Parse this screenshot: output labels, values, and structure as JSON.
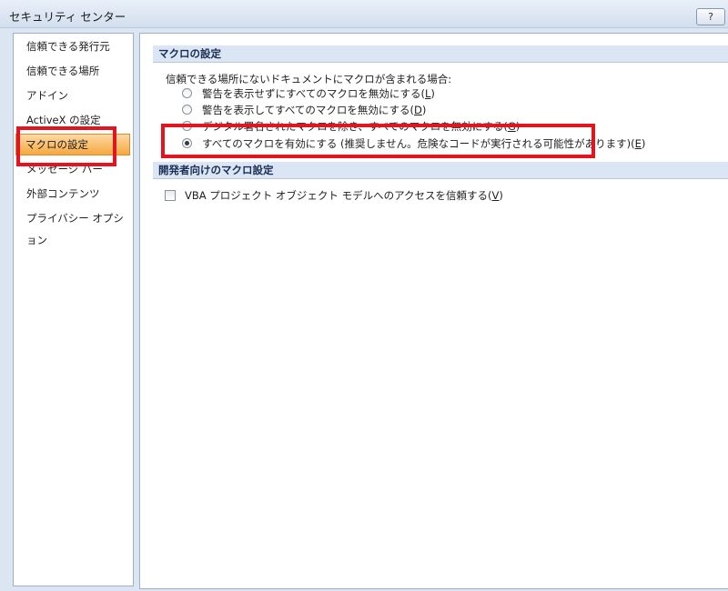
{
  "window": {
    "title": "セキュリティ センター",
    "help_label": "?"
  },
  "sidebar": {
    "items": [
      {
        "label": "信頼できる発行元"
      },
      {
        "label": "信頼できる場所"
      },
      {
        "label": "アドイン"
      },
      {
        "label": "ActiveX の設定"
      },
      {
        "label": "マクロの設定",
        "selected": true
      },
      {
        "label": "メッセージ バー"
      },
      {
        "label": "外部コンテンツ"
      },
      {
        "label": "プライバシー オプション"
      }
    ]
  },
  "macro_settings": {
    "header": "マクロの設定",
    "intro": "信頼できる場所にないドキュメントにマクロが含まれる場合:",
    "options": [
      {
        "label": "警告を表示せずにすべてのマクロを無効にする",
        "accel": "L",
        "checked": false
      },
      {
        "label": "警告を表示してすべてのマクロを無効にする",
        "accel": "D",
        "checked": false
      },
      {
        "label": "デジタル署名されたマクロを除き、すべてのマクロを無効にする",
        "accel": "G",
        "checked": false
      },
      {
        "label": "すべてのマクロを有効にする (推奨しません。危険なコードが実行される可能性があります)",
        "accel": "E",
        "checked": true
      }
    ]
  },
  "developer_settings": {
    "header": "開発者向けのマクロ設定",
    "vba_label": "VBA プロジェクト オブジェクト モデルへのアクセスを信頼する",
    "vba_accel": "V",
    "vba_checked": false
  },
  "colors": {
    "highlight": "#e3141f",
    "selected_nav": "#f6a840"
  }
}
